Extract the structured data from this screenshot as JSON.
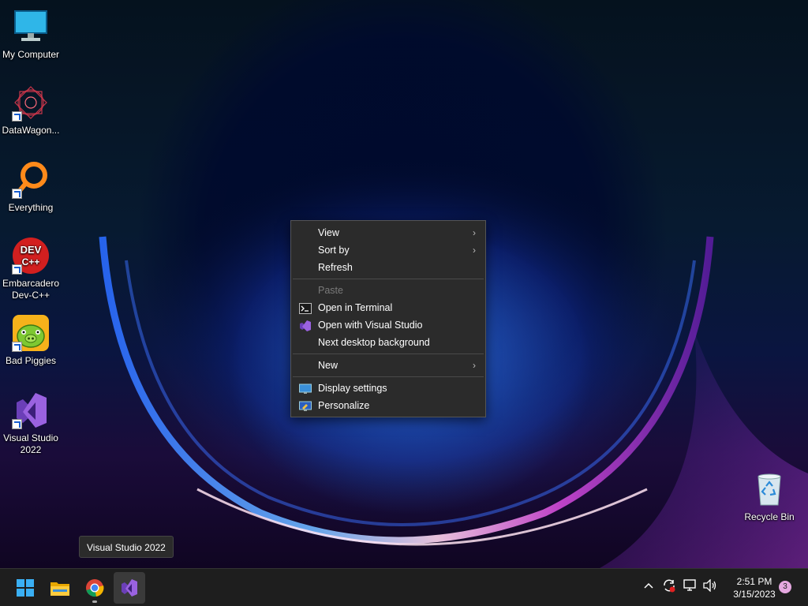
{
  "desktop": {
    "icons": [
      {
        "label": "My Computer",
        "icon": "monitor-icon"
      },
      {
        "label": "DataWagon...",
        "icon": "datawagon-icon"
      },
      {
        "label": "Everything",
        "icon": "everything-search-icon"
      },
      {
        "label": "Embarcadero Dev-C++",
        "icon": "devcpp-icon",
        "badge": "DEV C++"
      },
      {
        "label": "Bad Piggies",
        "icon": "bad-piggies-icon"
      },
      {
        "label": "Visual Studio 2022",
        "icon": "visual-studio-icon"
      }
    ],
    "recycle_bin": {
      "label": "Recycle Bin",
      "icon": "recycle-bin-icon"
    }
  },
  "context_menu": {
    "items": [
      {
        "label": "View",
        "submenu": true
      },
      {
        "label": "Sort by",
        "submenu": true
      },
      {
        "label": "Refresh"
      },
      {
        "label": "Paste",
        "disabled": true
      },
      {
        "label": "Open in Terminal",
        "icon": "terminal-icon"
      },
      {
        "label": "Open with Visual Studio",
        "icon": "visual-studio-icon"
      },
      {
        "label": "Next desktop background"
      },
      {
        "label": "New",
        "submenu": true
      },
      {
        "label": "Display settings",
        "icon": "display-settings-icon"
      },
      {
        "label": "Personalize",
        "icon": "personalize-icon"
      }
    ]
  },
  "tooltip": {
    "text": "Visual Studio 2022"
  },
  "taskbar": {
    "apps": [
      {
        "name": "Start",
        "icon": "windows-start-icon"
      },
      {
        "name": "File Explorer",
        "icon": "folder-icon"
      },
      {
        "name": "Google Chrome",
        "icon": "chrome-icon"
      },
      {
        "name": "Visual Studio 2022",
        "icon": "visual-studio-icon",
        "active": true
      }
    ],
    "tray": {
      "time": "2:51 PM",
      "date": "3/15/2023",
      "notification_count": "3"
    }
  },
  "colors": {
    "menu_bg": "#2b2b2b",
    "taskbar_bg": "#1e1e1e",
    "vs_purple": "#9a62e0",
    "notif_badge": "#e5a8e0"
  }
}
